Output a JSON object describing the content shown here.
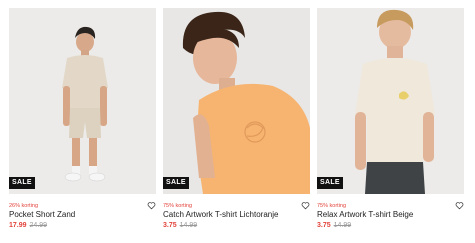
{
  "products": [
    {
      "sale_badge": "SALE",
      "discount": "26% korting",
      "name": "Pocket Short Zand",
      "price_sale": "17.99",
      "price_old": "24.99",
      "wishlist_icon": "heart-outline-icon",
      "colors": {
        "shirt": "#e3d8c8",
        "shorts": "#ddd2c0",
        "background": "#ecebe9"
      }
    },
    {
      "sale_badge": "SALE",
      "discount": "75% korting",
      "name": "Catch Artwork T-shirt Lichtoranje",
      "price_sale": "3.75",
      "price_old": "14.99",
      "wishlist_icon": "heart-outline-icon",
      "colors": {
        "shirt": "#f7b470",
        "background": "#e8e7e5"
      }
    },
    {
      "sale_badge": "SALE",
      "discount": "75% korting",
      "name": "Relax Artwork T-shirt Beige",
      "price_sale": "3.75",
      "price_old": "14.99",
      "wishlist_icon": "heart-outline-icon",
      "colors": {
        "shirt": "#efe8db",
        "pants": "#3f4346",
        "background": "#ecebe9"
      }
    }
  ],
  "accent_color": "#e2433b"
}
